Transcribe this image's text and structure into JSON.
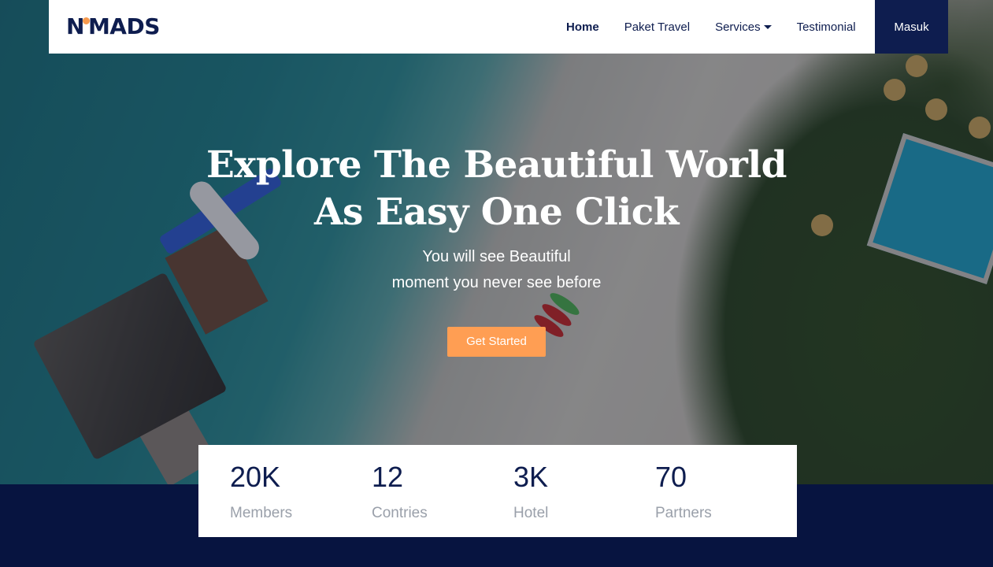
{
  "brand": {
    "logo_left": "N",
    "logo_right": "MADS",
    "accent": "#f79a4e",
    "primary": "#0e1d4f"
  },
  "nav": {
    "items": [
      {
        "label": "Home",
        "active": true
      },
      {
        "label": "Paket Travel",
        "active": false
      },
      {
        "label": "Services",
        "active": false,
        "has_dropdown": true
      },
      {
        "label": "Testimonial",
        "active": false
      }
    ],
    "login_label": "Masuk"
  },
  "hero": {
    "title_line1": "Explore The Beautiful World",
    "title_line2": "As Easy One Click",
    "subtitle_line1": "You will see Beautiful",
    "subtitle_line2": "moment you never see before",
    "cta_label": "Get Started",
    "cta_color": "#ff9e53"
  },
  "stats": [
    {
      "value": "20K",
      "label": "Members"
    },
    {
      "value": "12",
      "label": "Contries"
    },
    {
      "value": "3K",
      "label": "Hotel"
    },
    {
      "value": "70",
      "label": "Partners"
    }
  ]
}
